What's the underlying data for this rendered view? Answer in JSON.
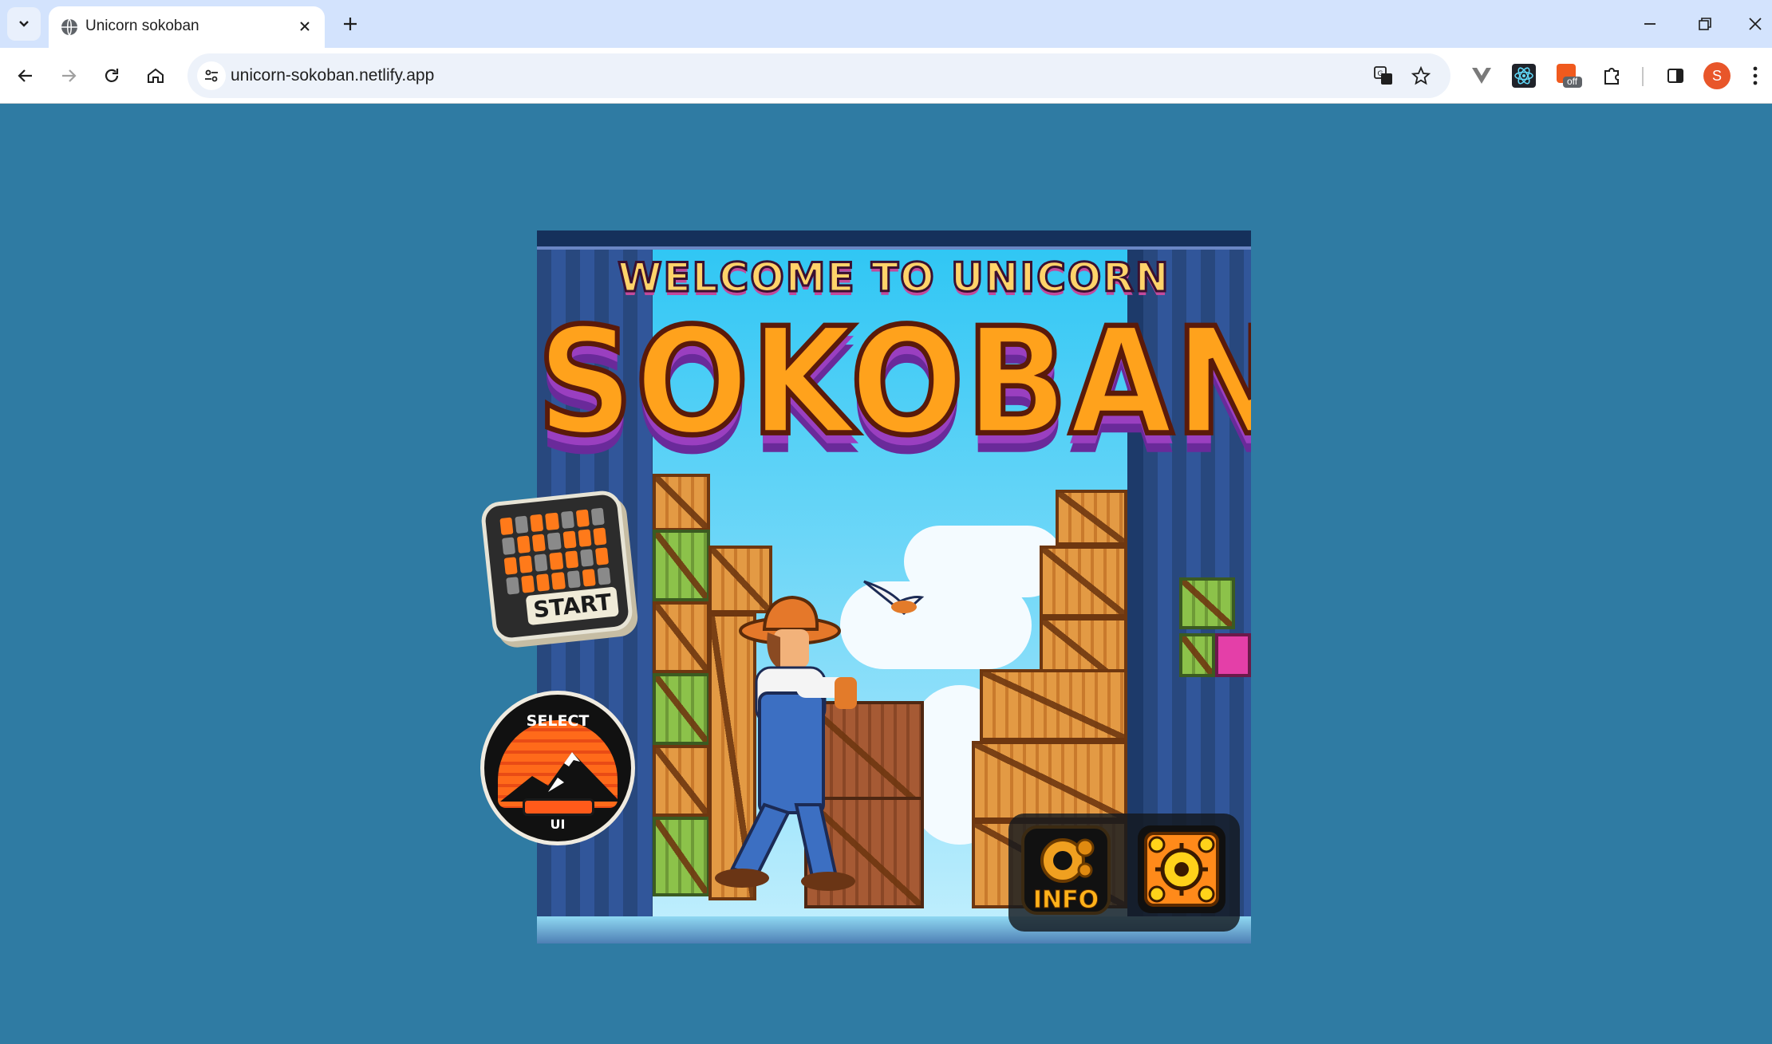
{
  "browser": {
    "tab_title": "Unicorn sokoban",
    "url": "unicorn-sokoban.netlify.app",
    "profile_initial": "S",
    "extension_badge": "off"
  },
  "game": {
    "welcome_text": "WELCOME TO UNICORN",
    "title_text": "SOKOBAN",
    "start_label": "START",
    "select_label_top": "SELECT",
    "select_label_bottom": "UI",
    "info_label": "INFO"
  },
  "colors": {
    "page_background": "#2f7ba3",
    "title_orange": "#ffa21c",
    "accent_orange": "#ff6a1a"
  }
}
